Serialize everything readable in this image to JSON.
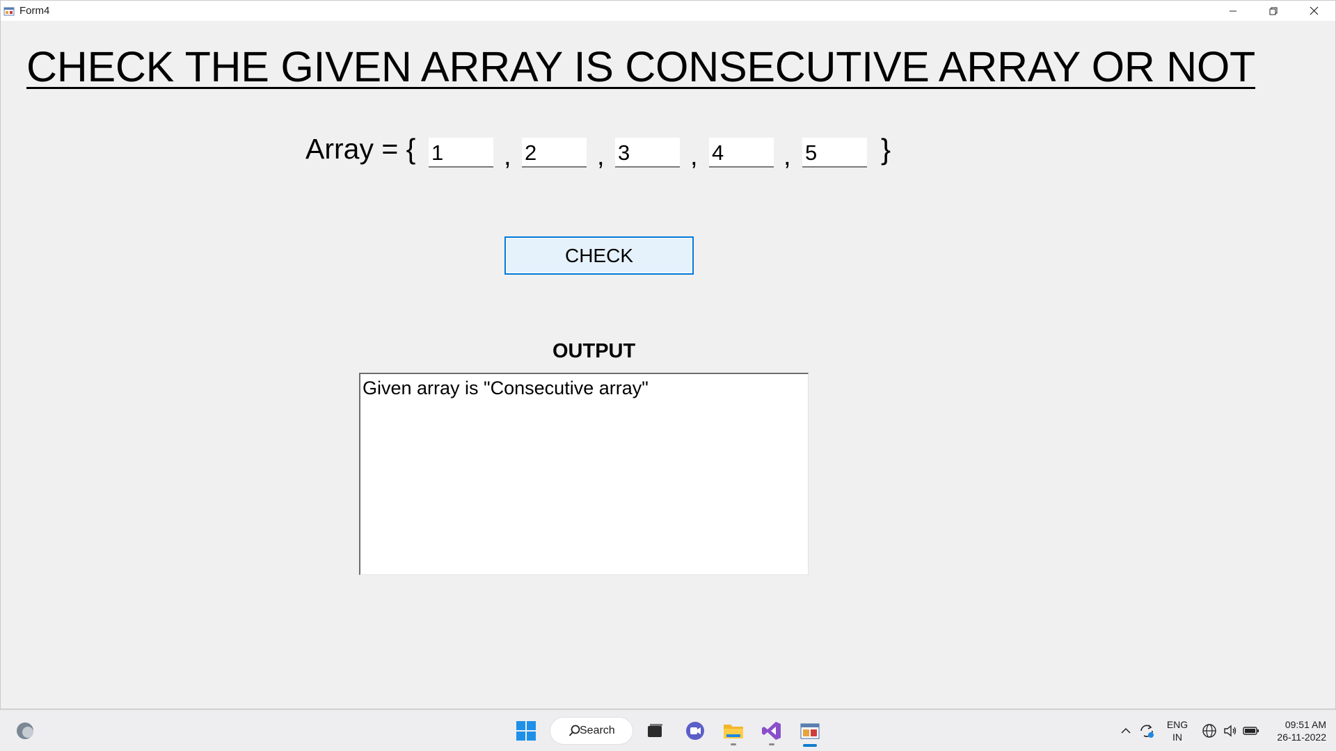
{
  "window": {
    "title": "Form4"
  },
  "form": {
    "heading": "CHECK THE GIVEN ARRAY IS CONSECUTIVE ARRAY OR NOT",
    "array_label": "Array = {",
    "comma": ",",
    "closing_brace": "}",
    "array_values": [
      "1",
      "2",
      "3",
      "4",
      "5"
    ],
    "check_button": "CHECK",
    "output_label": "OUTPUT",
    "output_text": "Given array is \"Consecutive array\""
  },
  "taskbar": {
    "search_label": "Search",
    "language_line1": "ENG",
    "language_line2": "IN",
    "time": "09:51 AM",
    "date": "26-11-2022"
  },
  "colors": {
    "accent": "#0078d7",
    "button_bg": "#e5f1fb",
    "window_bg": "#f0f0f0"
  }
}
